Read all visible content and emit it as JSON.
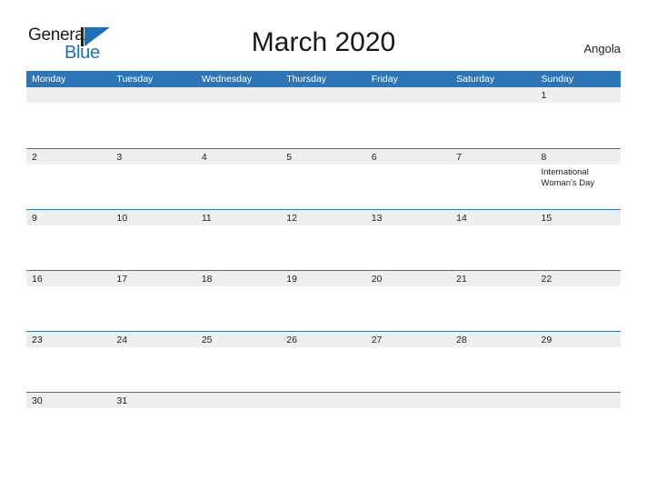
{
  "brand": {
    "name_part1": "General",
    "name_part2": "Blue",
    "mark": "flag-triangle-icon",
    "accent_color": "#1f6fb5"
  },
  "header": {
    "title": "March 2020",
    "country": "Angola"
  },
  "theme": {
    "header_blue": "#2e75b6",
    "band_gray": "#efefef",
    "text_dark": "#1c1c1c",
    "header_text": "#ffffff"
  },
  "calendar": {
    "month": "March",
    "year": "2020",
    "weekday_headers": [
      "Monday",
      "Tuesday",
      "Wednesday",
      "Thursday",
      "Friday",
      "Saturday",
      "Sunday"
    ],
    "weeks": [
      {
        "days": [
          {
            "number": "",
            "events": []
          },
          {
            "number": "",
            "events": []
          },
          {
            "number": "",
            "events": []
          },
          {
            "number": "",
            "events": []
          },
          {
            "number": "",
            "events": []
          },
          {
            "number": "",
            "events": []
          },
          {
            "number": "1",
            "events": []
          }
        ]
      },
      {
        "days": [
          {
            "number": "2",
            "events": []
          },
          {
            "number": "3",
            "events": []
          },
          {
            "number": "4",
            "events": []
          },
          {
            "number": "5",
            "events": []
          },
          {
            "number": "6",
            "events": []
          },
          {
            "number": "7",
            "events": []
          },
          {
            "number": "8",
            "events": [
              "International",
              "Woman's Day"
            ]
          }
        ]
      },
      {
        "days": [
          {
            "number": "9",
            "events": []
          },
          {
            "number": "10",
            "events": []
          },
          {
            "number": "11",
            "events": []
          },
          {
            "number": "12",
            "events": []
          },
          {
            "number": "13",
            "events": []
          },
          {
            "number": "14",
            "events": []
          },
          {
            "number": "15",
            "events": []
          }
        ]
      },
      {
        "days": [
          {
            "number": "16",
            "events": []
          },
          {
            "number": "17",
            "events": []
          },
          {
            "number": "18",
            "events": []
          },
          {
            "number": "19",
            "events": []
          },
          {
            "number": "20",
            "events": []
          },
          {
            "number": "21",
            "events": []
          },
          {
            "number": "22",
            "events": []
          }
        ]
      },
      {
        "days": [
          {
            "number": "23",
            "events": []
          },
          {
            "number": "24",
            "events": []
          },
          {
            "number": "25",
            "events": []
          },
          {
            "number": "26",
            "events": []
          },
          {
            "number": "27",
            "events": []
          },
          {
            "number": "28",
            "events": []
          },
          {
            "number": "29",
            "events": []
          }
        ]
      },
      {
        "days": [
          {
            "number": "30",
            "events": []
          },
          {
            "number": "31",
            "events": []
          },
          {
            "number": "",
            "events": []
          },
          {
            "number": "",
            "events": []
          },
          {
            "number": "",
            "events": []
          },
          {
            "number": "",
            "events": []
          },
          {
            "number": "",
            "events": []
          }
        ]
      }
    ]
  }
}
